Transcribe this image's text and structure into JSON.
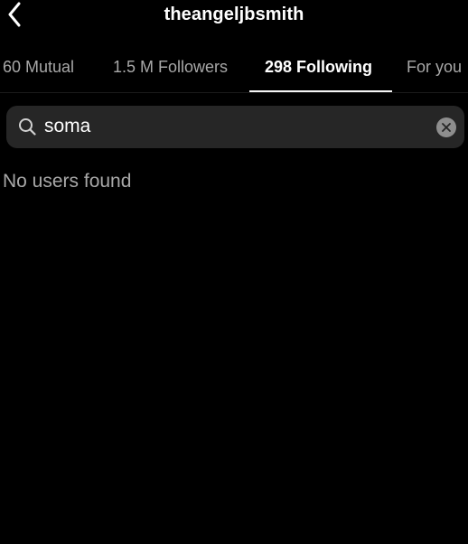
{
  "header": {
    "back_icon": "chevron-left-icon",
    "title": "theangeljbsmith"
  },
  "tabs": [
    {
      "label": "60 Mutual",
      "active": false
    },
    {
      "label": "1.5 M Followers",
      "active": false
    },
    {
      "label": "298 Following",
      "active": true
    },
    {
      "label": "For you",
      "active": false
    }
  ],
  "search": {
    "icon": "search-icon",
    "value": "soma",
    "placeholder": "Search",
    "clear_icon": "clear-icon"
  },
  "results": {
    "empty_message": "No users found"
  },
  "colors": {
    "background": "#000000",
    "text_primary": "#ffffff",
    "text_secondary": "#a8a8a8",
    "search_field": "#262626",
    "clear_button": "#8e8e8e"
  }
}
